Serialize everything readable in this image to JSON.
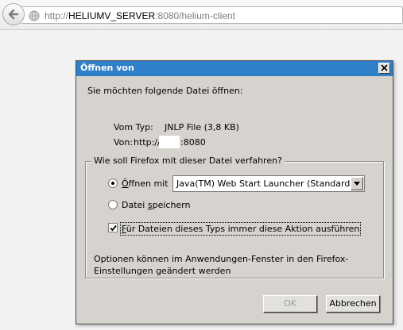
{
  "browser": {
    "url_prefix": "http://",
    "url_host": "HELIUMV_SERVER",
    "url_rest": ":8080/helium-client"
  },
  "dialog": {
    "title": "Öffnen von",
    "prompt": "Sie möchten folgende Datei öffnen:",
    "type_label": "Vom Typ:",
    "type_value": "JNLP File (3,8 KB)",
    "from_label": "Von:",
    "from_prefix": "http://",
    "from_port": ":8080",
    "group_legend": "Wie soll Firefox mit dieser Datei verfahren?",
    "open_with_label_mnemonic": "Ö",
    "open_with_label_rest": "ffnen mit",
    "open_with_selected": "Java(TM) Web Start Launcher (Standard)",
    "save_label_prefix": "Datei ",
    "save_label_mnemonic": "s",
    "save_label_rest": "peichern",
    "always_mnemonic": "F",
    "always_rest": "ür Dateien dieses Typs immer diese Aktion ausführen",
    "options_note": "Optionen können im Anwendungen-Fenster in den Firefox-Einstellungen geändert werden",
    "ok_label": "OK",
    "cancel_label": "Abbrechen",
    "open_with_checked": true,
    "always_checked": true
  },
  "colors": {
    "titlebar": "#2f7fc9",
    "dialog_face": "#d6d3ce",
    "page_bg": "#f2f2f2"
  },
  "icons": {
    "back": "back-arrow-icon",
    "site": "globe-icon",
    "close": "close-icon",
    "dropdown": "chevron-down-icon",
    "check": "checkmark-icon"
  }
}
